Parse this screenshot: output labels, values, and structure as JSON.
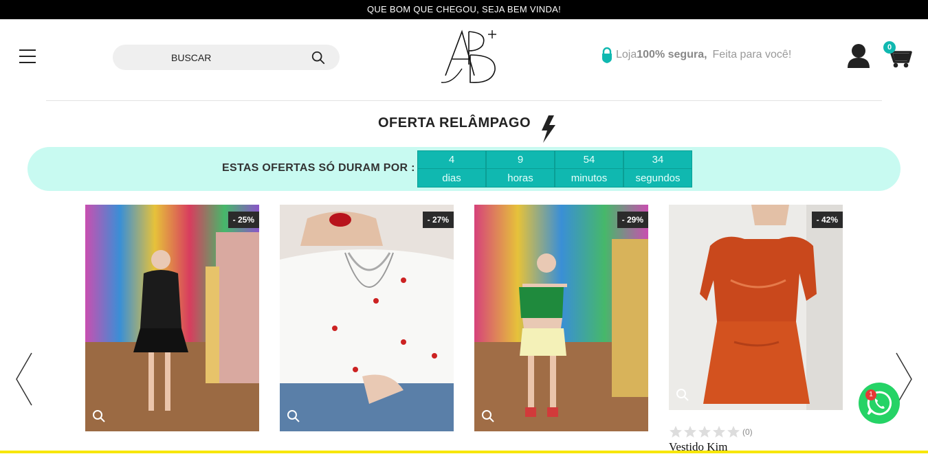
{
  "topbar": {
    "message": "QUE BOM QUE CHEGOU, SEJA BEM VINDA!"
  },
  "header": {
    "search_placeholder": "BUSCAR",
    "secure_prefix": "Loja",
    "secure_bold": "100% segura,",
    "slogan": "Feita para você!",
    "cart_count": "0"
  },
  "flash": {
    "title": "OFERTA RELÂMPAGO",
    "countdown_label": "ESTAS OFERTAS SÓ DURAM POR :",
    "timer": [
      {
        "value": "4",
        "unit": "dias"
      },
      {
        "value": "9",
        "unit": "horas"
      },
      {
        "value": "54",
        "unit": "minutos"
      },
      {
        "value": "34",
        "unit": "segundos"
      }
    ]
  },
  "products": [
    {
      "discount": "- 25%",
      "name": "",
      "reviews": ""
    },
    {
      "discount": "- 27%",
      "name": "",
      "reviews": ""
    },
    {
      "discount": "- 29%",
      "name": "",
      "reviews": ""
    },
    {
      "discount": "- 42%",
      "name": "Vestido Kim",
      "reviews": "(0)"
    }
  ],
  "whatsapp": {
    "badge": "1"
  },
  "colors": {
    "accent": "#10b8b0",
    "countdown_bg": "#c8faf1",
    "whatsapp": "#25d366"
  }
}
